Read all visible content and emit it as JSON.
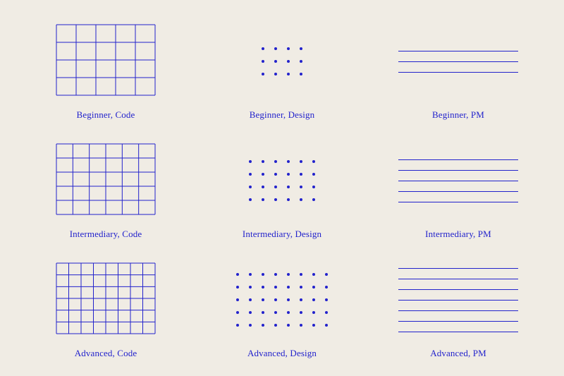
{
  "cards": [
    {
      "id": "beginner-code",
      "label": "Beginner, Code",
      "type": "grid",
      "gridCols": 5,
      "gridRows": 4
    },
    {
      "id": "beginner-design",
      "label": "Beginner, Design",
      "type": "dots",
      "cols": 4,
      "rows": 3
    },
    {
      "id": "beginner-pm",
      "label": "Beginner, PM",
      "type": "lines",
      "count": 3
    },
    {
      "id": "intermediary-code",
      "label": "Intermediary, Code",
      "type": "grid",
      "gridCols": 6,
      "gridRows": 5
    },
    {
      "id": "intermediary-design",
      "label": "Intermediary, Design",
      "type": "dots",
      "cols": 6,
      "rows": 4
    },
    {
      "id": "intermediary-pm",
      "label": "Intermediary, PM",
      "type": "lines",
      "count": 5
    },
    {
      "id": "advanced-code",
      "label": "Advanced, Code",
      "type": "grid",
      "gridCols": 8,
      "gridRows": 6
    },
    {
      "id": "advanced-design",
      "label": "Advanced, Design",
      "type": "dots",
      "cols": 8,
      "rows": 5
    },
    {
      "id": "advanced-pm",
      "label": "Advanced, PM",
      "type": "lines",
      "count": 7
    }
  ],
  "colors": {
    "accent": "#2222cc",
    "background": "#f0ece4"
  }
}
